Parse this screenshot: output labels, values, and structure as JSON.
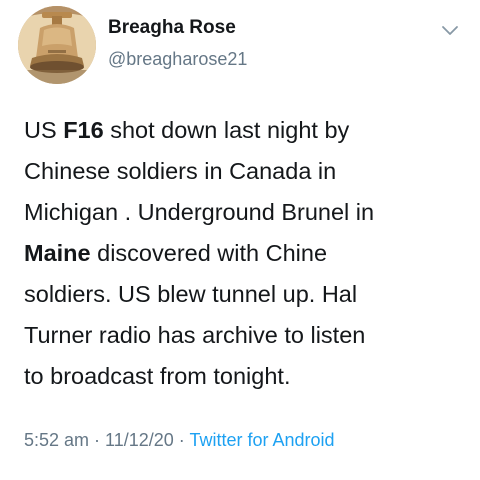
{
  "user": {
    "display_name": "Breagha Rose",
    "handle": "@breagharose21",
    "avatar_icon": "bell-avatar-icon"
  },
  "menu_icon": "chevron-down-icon",
  "tweet": {
    "lines": [
      [
        {
          "text": "US ",
          "bold": false
        },
        {
          "text": "F16",
          "bold": true
        },
        {
          "text": " shot down last night by",
          "bold": false
        }
      ],
      [
        {
          "text": "Chinese soldiers in Canada in",
          "bold": false
        }
      ],
      [
        {
          "text": "Michigan . Underground Brunel in",
          "bold": false
        }
      ],
      [
        {
          "text": "Maine",
          "bold": true
        },
        {
          "text": " discovered with Chine",
          "bold": false
        }
      ],
      [
        {
          "text": "soldiers. US blew tunnel up. Hal",
          "bold": false
        }
      ],
      [
        {
          "text": "Turner radio has archive to listen",
          "bold": false
        }
      ],
      [
        {
          "text": "to broadcast from tonight.",
          "bold": false
        }
      ]
    ]
  },
  "meta": {
    "time": "5:52 am",
    "sep1": " · ",
    "date": "11/12/20",
    "sep2": " · ",
    "source": "Twitter for Android"
  },
  "colors": {
    "text": "#14171a",
    "secondary": "#657786",
    "link": "#1da1f2"
  }
}
